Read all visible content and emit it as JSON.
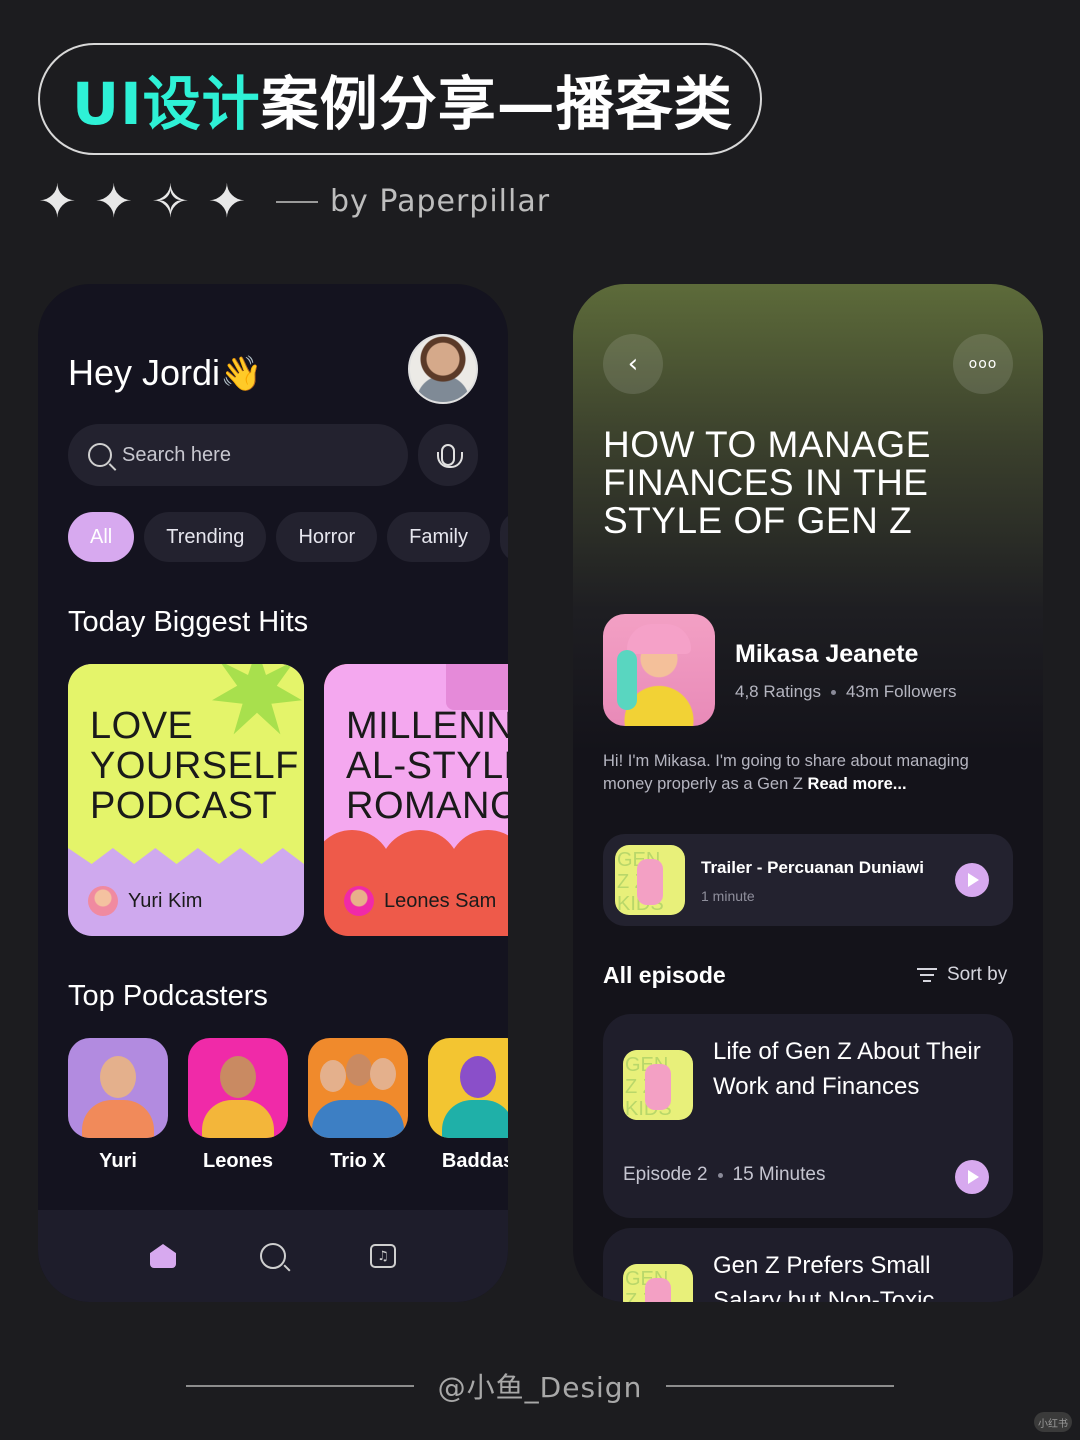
{
  "header": {
    "title_accent": "UI设计",
    "title_rest": "案例分享—播客类",
    "stars": [
      "✦",
      "✦",
      "✧",
      "✦"
    ],
    "byline": "by Paperpillar"
  },
  "left": {
    "greeting": "Hey Jordi",
    "greeting_emoji": "👋",
    "search_placeholder": "Search here",
    "chips": [
      "All",
      "Trending",
      "Horror",
      "Family"
    ],
    "hits_title": "Today Biggest Hits",
    "hits": [
      {
        "title": "LOVE\nYOURSELF\nPODCAST",
        "host": "Yuri Kim"
      },
      {
        "title": "MILLENNI\nAL-STYLE\nROMANCE",
        "host": "Leones Sam"
      }
    ],
    "podcasters_title": "Top Podcasters",
    "podcasters": [
      "Yuri",
      "Leones",
      "Trio X",
      "Baddas"
    ],
    "nav": [
      "home-icon",
      "search-icon",
      "library-icon"
    ],
    "accent": "#d7a9ef"
  },
  "right": {
    "title": "HOW TO MANAGE FINANCES IN THE STYLE OF GEN Z",
    "more_glyph": "ooo",
    "back_glyph": "‹",
    "host_name": "Mikasa Jeanete",
    "ratings": "4,8 Ratings",
    "followers": "43m Followers",
    "bio": "Hi! I'm Mikasa. I'm going to share about managing money properly as a Gen Z",
    "read_more": "Read more...",
    "thumb_label": "GEN\nZ Z\nKIDS",
    "trailer_title": "Trailer - Percuanan Duniawi",
    "trailer_length": "1 minute",
    "all_episode": "All episode",
    "sort_by": "Sort by",
    "episodes": [
      {
        "title": "Life of Gen Z About Their Work and Finances",
        "episode": "Episode 2",
        "length": "15 Minutes"
      },
      {
        "title": "Gen Z Prefers Small Salary but Non-Toxic"
      }
    ]
  },
  "footer": {
    "credit": "@小鱼_Design",
    "watermark": "小红书"
  }
}
